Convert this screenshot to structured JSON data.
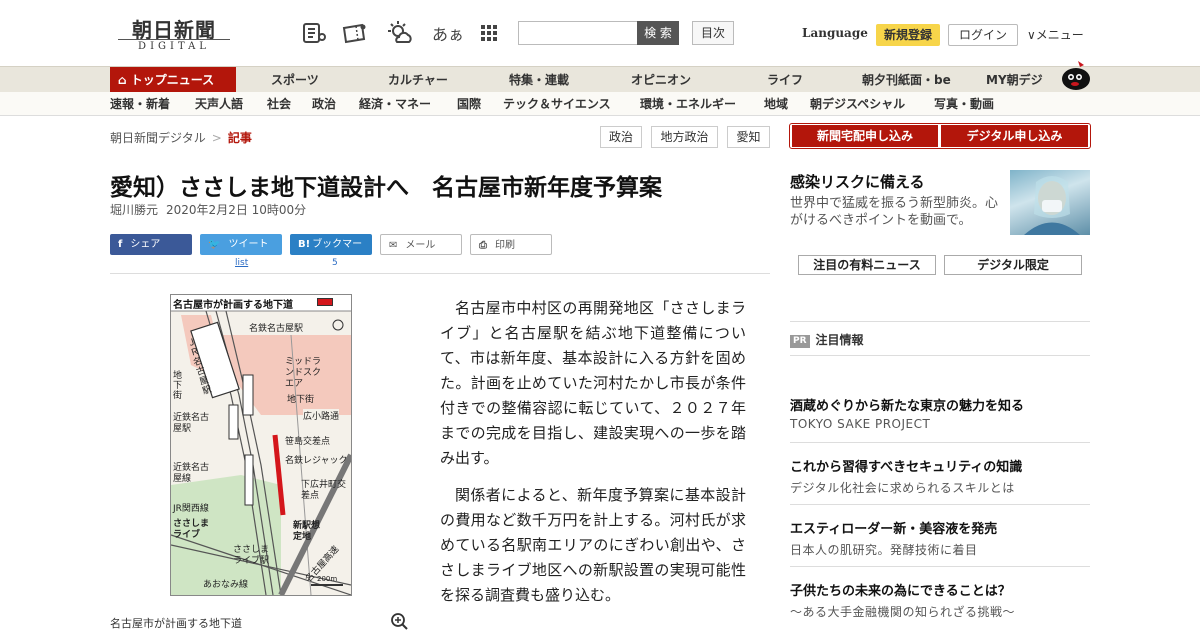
{
  "header": {
    "logo_main": "朝日新聞",
    "logo_sub": "DIGITAL",
    "font_size_label": "あぁ",
    "search_placeholder": "",
    "search_button": "検 索",
    "index_button": "目次",
    "language": "Language",
    "register": "新規登録",
    "login": "ログイン",
    "menu": "メニュー"
  },
  "nav_primary": {
    "top": "トップニュース",
    "items": [
      "スポーツ",
      "カルチャー",
      "特集・連載",
      "オピニオン",
      "ライフ",
      "朝夕刊紙面・be",
      "MY朝デジ"
    ]
  },
  "nav_secondary": {
    "items": [
      "速報・新着",
      "天声人語",
      "社会",
      "政治",
      "経済・マネー",
      "国際",
      "テック＆サイエンス",
      "環境・エネルギー",
      "地域",
      "朝デジスペシャル",
      "写真・動画"
    ]
  },
  "breadcrumb": {
    "home": "朝日新聞デジタル",
    "current": "記事"
  },
  "tags": [
    "政治",
    "地方政治",
    "愛知"
  ],
  "article": {
    "headline": "愛知）ささしま地下道設計へ　名古屋市新年度予算案",
    "author": "堀川勝元",
    "date": "2020年2月2日 10時00分",
    "share": {
      "facebook": "シェア",
      "twitter": "ツイート",
      "twitter_sub": "list",
      "hatena": "ブックマーク",
      "hatena_count": "5",
      "mail": "メール",
      "print": "印刷"
    },
    "map": {
      "title": "名古屋市が計画する地下道",
      "labels": [
        "名鉄名古屋駅",
        "ＪＲ名古屋駅",
        "ミッドランドスクエア",
        "地下街",
        "地下街",
        "広小路通",
        "近鉄名古屋駅",
        "笹島交差点",
        "名鉄レジャック",
        "下広井町交差点",
        "近鉄名古屋線",
        "JR関西線",
        "ささしまライブ",
        "新駅想定地",
        "ささしまライブ駅",
        "名古屋高速",
        "あおなみ線",
        "200m"
      ]
    },
    "caption": "名古屋市が計画する地下道",
    "paragraphs": [
      "名古屋市中村区の再開発地区「ささしまライブ」と名古屋駅を結ぶ地下道整備について、市は新年度、基本設計に入る方針を固めた。計画を止めていた河村たかし市長が条件付きでの整備容認に転じていて、２０２７年までの完成を目指し、建設実現への一歩を踏み出す。",
      "関係者によると、新年度予算案に基本設計の費用など数千万円を計上する。河村氏が求めている名駅南エリアのにぎわい創出や、ささしまライブ地区への新駅設置の実現可能性を探る調査費も盛り込む。"
    ]
  },
  "sidebar": {
    "subscribe_paper": "新聞宅配申し込み",
    "subscribe_digital": "デジタル申し込み",
    "promo_title": "感染リスクに備える",
    "promo_desc": "世界中で猛威を振るう新型肺炎。心がけるべきポイントを動画で。",
    "tab_premium": "注目の有料ニュース",
    "tab_digital": "デジタル限定",
    "pr_badge": "PR",
    "pr_heading": "注目情報",
    "pr_items": [
      {
        "title": "酒蔵めぐりから新たな東京の魅力を知る",
        "sub": "TOKYO SAKE PROJECT"
      },
      {
        "title": "これから習得すべきセキュリティの知識",
        "sub": "デジタル化社会に求められるスキルとは"
      },
      {
        "title": "エスティローダー新・美容液を発売",
        "sub": "日本人の肌研究。発酵技術に着目"
      },
      {
        "title": "子供たちの未来の為にできることは？",
        "sub": "～ある大手金融機関の知られざる挑戦～"
      }
    ]
  },
  "colors": {
    "brand_red": "#b3160b",
    "nav_bg": "#e9e6dc",
    "register_yellow": "#f7d54a",
    "facebook": "#3b5998",
    "twitter": "#4a9fe0",
    "hatena": "#2b80c5"
  },
  "icons": [
    "newspaper-icon",
    "ticket-icon",
    "weather-icon",
    "apps-grid-icon",
    "chevron-down-icon",
    "home-icon",
    "zoom-icon"
  ]
}
